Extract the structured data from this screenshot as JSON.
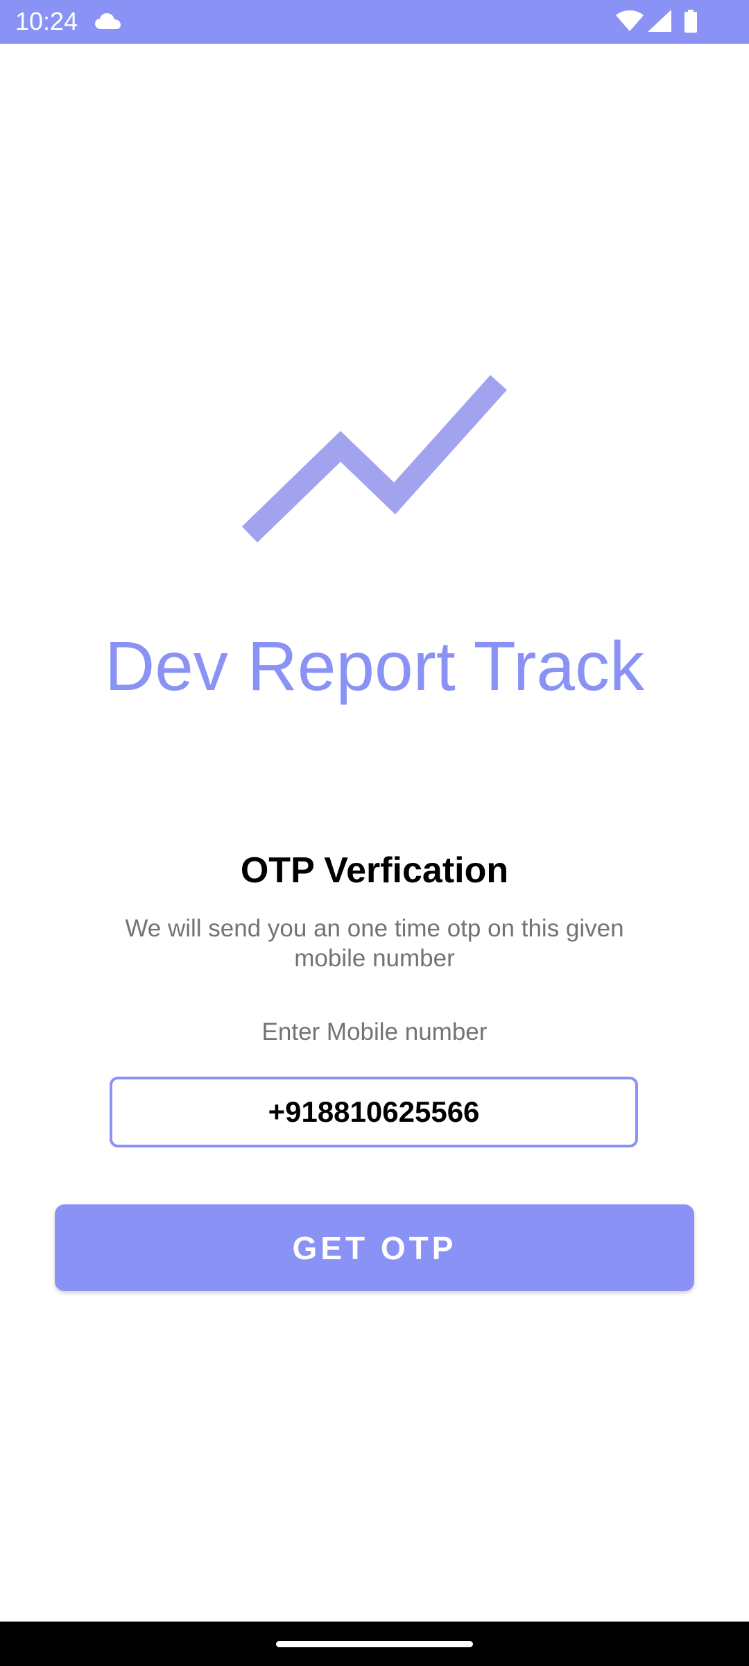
{
  "status_bar": {
    "time": "10:24",
    "icons": [
      "cloud-icon",
      "wifi-icon",
      "signal-icon",
      "battery-icon"
    ],
    "background": "#8a93f5"
  },
  "app": {
    "logo_icon": "trend-line-icon",
    "title": "Dev Report Track",
    "accent_color": "#8a93f5"
  },
  "otp": {
    "heading": "OTP Verfication",
    "description": "We will send you an one time otp on this given mobile number",
    "field_label": "Enter Mobile number",
    "mobile_value": "+918810625566",
    "button_label": "GET OTP"
  }
}
